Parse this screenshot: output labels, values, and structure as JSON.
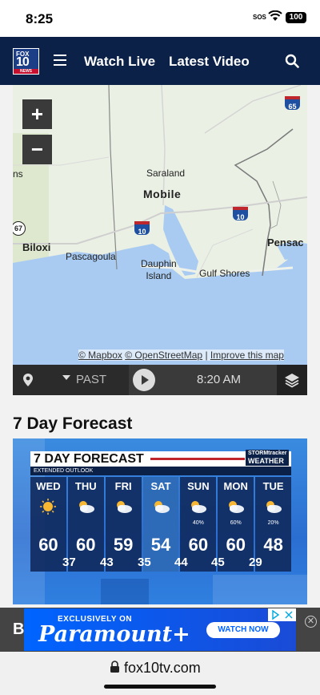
{
  "status_bar": {
    "time": "8:25",
    "sos": "SOS",
    "battery": "100"
  },
  "nav": {
    "logo": {
      "top": "FOX",
      "number": "10",
      "bottom": "NEWS"
    },
    "links": [
      "Watch Live",
      "Latest Video"
    ]
  },
  "map": {
    "zoom_in": "+",
    "zoom_out": "−",
    "cities": {
      "saraland": "Saraland",
      "mobile": "Mobile",
      "biloxi": "Biloxi",
      "pascagoula": "Pascagoula",
      "dauphin_island": "Dauphin\nIsland",
      "gulf_shores": "Gulf Shores",
      "pensacola": "Pensac",
      "left_cut": "ns"
    },
    "highway_shields": {
      "i65": "65",
      "i10_west": "10",
      "i10_east": "10",
      "us67": "67"
    },
    "attribution": {
      "mapbox": "© Mapbox",
      "osm": "© OpenStreetMap",
      "sep": "|",
      "improve": "Improve this map"
    }
  },
  "playback": {
    "past_label": "PAST",
    "time": "8:20 AM"
  },
  "forecast_section": {
    "title": "7 Day Forecast",
    "graphic": {
      "heading": "7 DAY FORECAST",
      "subheading": "EXTENDED OUTLOOK",
      "brand_top": "STORMtracker",
      "brand_bottom": "WEATHER",
      "days": [
        {
          "name": "WED",
          "hi": "60",
          "lo": "37",
          "precip": "",
          "icon": "sunny-icon"
        },
        {
          "name": "THU",
          "hi": "60",
          "lo": "43",
          "precip": "",
          "icon": "partly-cloudy-icon"
        },
        {
          "name": "FRI",
          "hi": "59",
          "lo": "35",
          "precip": "",
          "icon": "partly-cloudy-icon"
        },
        {
          "name": "SAT",
          "hi": "54",
          "lo": "44",
          "precip": "",
          "icon": "partly-cloudy-icon"
        },
        {
          "name": "SUN",
          "hi": "60",
          "lo": "45",
          "precip": "40%",
          "icon": "partly-cloudy-icon"
        },
        {
          "name": "MON",
          "hi": "60",
          "lo": "29",
          "precip": "60%",
          "icon": "partly-cloudy-icon"
        },
        {
          "name": "TUE",
          "hi": "48",
          "lo": "",
          "precip": "20%",
          "icon": "partly-cloudy-icon"
        }
      ]
    }
  },
  "ad": {
    "exclusive": "EXCLUSIVELY ON",
    "brand": "Paramount+",
    "cta": "WATCH NOW",
    "close": "✕",
    "peek_letter": "B"
  },
  "browser": {
    "url": "fox10tv.com"
  }
}
